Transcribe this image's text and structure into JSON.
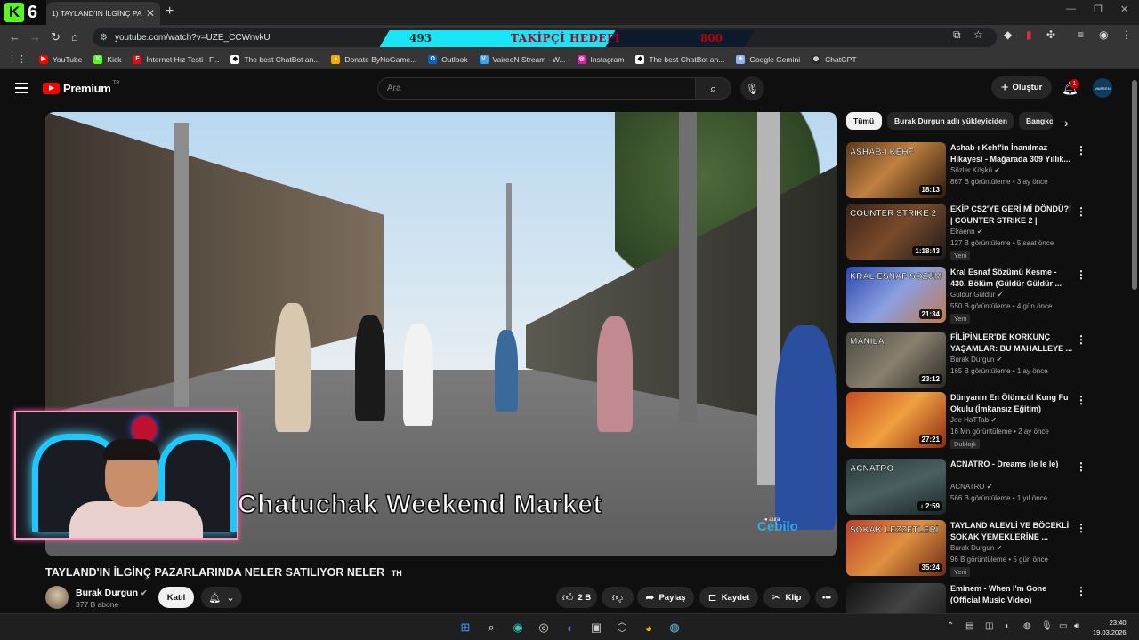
{
  "browser": {
    "kick_badge": {
      "letter": "K",
      "number": "6"
    },
    "tab": {
      "title": "1) TAYLAND'IN İLGİNÇ PAZARL",
      "close": "✕"
    },
    "new_tab": "+",
    "window_controls": {
      "minimize": "—",
      "restore": "❐",
      "close": "✕"
    },
    "url": "youtube.com/watch?v=UZE_CCWrwkU",
    "follow_goal": {
      "current": "493",
      "title": "TAKİPÇİ HEDEFİ",
      "target": "800",
      "progress": 0.62
    },
    "bookmarks": [
      {
        "label": "YouTube",
        "icon": "youtube-icon",
        "color": "#ff0000",
        "glyph": "▶"
      },
      {
        "label": "Kick",
        "icon": "kick-icon",
        "color": "#53fc18",
        "glyph": "K"
      },
      {
        "label": "İnternet Hız Testi | F...",
        "icon": "speedtest-icon",
        "color": "#e50914",
        "glyph": "F"
      },
      {
        "label": "The best ChatBot an...",
        "icon": "chatbot-icon",
        "color": "#ffffff",
        "glyph": "◆"
      },
      {
        "label": "Donate ByNoGame...",
        "icon": "donate-icon",
        "color": "#f2a900",
        "glyph": "●"
      },
      {
        "label": "Outlook",
        "icon": "outlook-icon",
        "color": "#0a64c8",
        "glyph": "O"
      },
      {
        "label": "VaireeN Stream - W...",
        "icon": "stream-icon",
        "color": "#3aa0ff",
        "glyph": "V"
      },
      {
        "label": "Instagram",
        "icon": "instagram-icon",
        "color": "#d6249f",
        "glyph": "◎"
      },
      {
        "label": "The best ChatBot an...",
        "icon": "chatbot-icon",
        "color": "#ffffff",
        "glyph": "◆"
      },
      {
        "label": "Google Gemini",
        "icon": "gemini-icon",
        "color": "#8ab4f8",
        "glyph": "✦"
      },
      {
        "label": "ChatGPT",
        "icon": "chatgpt-icon",
        "color": "#2b2b2b",
        "glyph": "◍"
      }
    ]
  },
  "youtube": {
    "brand": "Premium",
    "region": "TR",
    "search_placeholder": "Ara",
    "create_label": "Oluştur",
    "notification_count": "1",
    "avatar_text": "VAIREEN"
  },
  "video": {
    "overlay_title": "Chatuchak Weekend Market",
    "watermark": "Cebilo",
    "watermark_brand": "● aura",
    "title": "TAYLAND'IN İLGİNÇ PAZARLARINDA NELER SATILIYOR NELER",
    "title_suffix": "TH",
    "channel": "Burak Durgun",
    "subscribers": "377 B abone",
    "join_label": "Katıl",
    "likes": "2 B",
    "share_label": "Paylaş",
    "save_label": "Kaydet",
    "clip_label": "Klip",
    "more": "•••"
  },
  "sidebar": {
    "chips": [
      "Tümü",
      "Burak Durgun adlı yükleyiciden",
      "Bangkok"
    ],
    "recommendations": [
      {
        "title": "Ashab-ı Kehf'in İnanılmaz Hikayesi - Mağarada 309 Yıllık...",
        "channel": "Sözler Köşkü",
        "verified": true,
        "meta": "867 B görüntüleme • 3 ay önce",
        "duration": "18:13",
        "badge": "",
        "thumb": "linear-gradient(135deg,#5a3a1c,#c08040 45%,#2a1a0c)",
        "thumb_text": "ASHAB-I KEHF"
      },
      {
        "title": "EKİP CS2'YE GERİ Mİ DÖNDÜ?! | COUNTER STRIKE 2 |",
        "channel": "Elraenn",
        "verified": true,
        "meta": "127 B görüntüleme • 5 saat önce",
        "duration": "1:18:43",
        "badge": "Yeni",
        "thumb": "linear-gradient(135deg,#3a2418,#7a4a2a 50%,#1a1a1a)",
        "thumb_text": "COUNTER STRIKE 2"
      },
      {
        "title": "Kral Esnaf Sözümü Kesme - 430. Bölüm (Güldür Güldür ...",
        "channel": "Güldür Güldür",
        "verified": true,
        "meta": "550 B görüntüleme • 4 gün önce",
        "duration": "21:34",
        "badge": "Yeni",
        "thumb": "linear-gradient(135deg,#2a48b0,#8aa0e0 50%,#c07a50)",
        "thumb_text": "KRAL ESNAF SÖZÜMÜ KES"
      },
      {
        "title": "FİLİPİNLER'DE KORKUNÇ YAŞAMLAR: BU MAHALLEYE ...",
        "channel": "Burak Durgun",
        "verified": true,
        "meta": "165 B görüntüleme • 1 ay önce",
        "duration": "23:12",
        "badge": "",
        "thumb": "linear-gradient(135deg,#4a4a40,#8a8070 50%,#2a2a24)",
        "thumb_text": "MANILA"
      },
      {
        "title": "Dünyanın En Ölümcül Kung Fu Okulu (İmkansız Eğitim)",
        "channel": "Joe HaTTab",
        "verified": true,
        "meta": "16 Mn görüntüleme • 2 ay önce",
        "duration": "27:21",
        "badge": "Dublajlı",
        "thumb": "linear-gradient(135deg,#c84a20,#f0a040 50%,#8a2a10)",
        "thumb_text": ""
      },
      {
        "title": "ACNATRO - Dreams (le le le)",
        "channel": "ACNATRO",
        "verified": true,
        "meta": "566 B görüntüleme • 1 yıl önce",
        "duration": "♪ 2:59",
        "badge": "",
        "thumb": "linear-gradient(160deg,#2a3a3a,#4a6060 50%,#1a2424)",
        "thumb_text": "ACNATRO"
      },
      {
        "title": "TAYLAND ALEVLİ VE BÖCEKLİ SOKAK YEMEKLERİNE ...",
        "channel": "Burak Durgun",
        "verified": true,
        "meta": "96 B görüntüleme • 5 gün önce",
        "duration": "35:24",
        "badge": "Yeni",
        "thumb": "linear-gradient(135deg,#c0402a,#e09040 50%,#6a2a14)",
        "thumb_text": "SOKAK LEZZETLERİ"
      },
      {
        "title": "Eminem - When I'm Gone (Official Music Video)",
        "channel": "",
        "verified": false,
        "meta": "",
        "duration": "",
        "badge": "",
        "thumb": "linear-gradient(135deg,#111,#444 50%,#111)",
        "thumb_text": ""
      }
    ]
  },
  "taskbar": {
    "apps": [
      {
        "name": "start-icon",
        "glyph": "⊞",
        "color": "#3aa0ff"
      },
      {
        "name": "search-icon",
        "glyph": "⌕",
        "color": "#ffffff"
      },
      {
        "name": "edge-icon",
        "glyph": "◉",
        "color": "#2ec4b6"
      },
      {
        "name": "obs-icon",
        "glyph": "◎",
        "color": "#dddddd"
      },
      {
        "name": "discord-icon",
        "glyph": "◐",
        "color": "#5865f2"
      },
      {
        "name": "epic-games-icon",
        "glyph": "▣",
        "color": "#cccccc"
      },
      {
        "name": "app-icon",
        "glyph": "⬡",
        "color": "#cccccc"
      },
      {
        "name": "chrome-icon",
        "glyph": "◕",
        "color": "#fbbc04"
      },
      {
        "name": "steam-icon",
        "glyph": "◍",
        "color": "#66c0f4"
      }
    ],
    "time": "23:40",
    "date": "19.03.2026"
  }
}
